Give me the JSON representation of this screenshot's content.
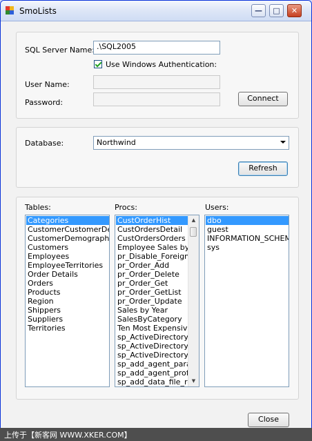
{
  "window": {
    "title": "SmoLists"
  },
  "connection": {
    "server_label": "SQL Server Name:",
    "server_value": ".\\SQL2005",
    "windows_auth_label": "Use Windows Authentication:",
    "username_label": "User Name:",
    "password_label": "Password:",
    "connect_label": "Connect"
  },
  "database": {
    "label": "Database:",
    "selected": "Northwind",
    "refresh_label": "Refresh"
  },
  "lists": {
    "tables_label": "Tables:",
    "procs_label": "Procs:",
    "users_label": "Users:",
    "tables": [
      "Categories",
      "CustomerCustomerDemo",
      "CustomerDemographics",
      "Customers",
      "Employees",
      "EmployeeTerritories",
      "Order Details",
      "Orders",
      "Products",
      "Region",
      "Shippers",
      "Suppliers",
      "Territories"
    ],
    "procs": [
      "CustOrderHist",
      "CustOrdersDetail",
      "CustOrdersOrders",
      "Employee Sales by Country",
      "pr_Disable_Foreign_Keys",
      "pr_Order_Add",
      "pr_Order_Delete",
      "pr_Order_Get",
      "pr_Order_GetList",
      "pr_Order_Update",
      "Sales by Year",
      "SalesByCategory",
      "Ten Most Expensive Products",
      "sp_ActiveDirectory_Obj",
      "sp_ActiveDirectory_SCP",
      "sp_ActiveDirectory_Start",
      "sp_add_agent_parameter",
      "sp_add_agent_profile",
      "sp_add_data_file_recover"
    ],
    "users": [
      "dbo",
      "guest",
      "INFORMATION_SCHEMA",
      "sys"
    ]
  },
  "close_label": "Close",
  "watermark": "上传于【新客网 WWW.XKER.COM】",
  "colors": {
    "selection": "#3399ff",
    "titlebar": "#dfe7f7"
  }
}
